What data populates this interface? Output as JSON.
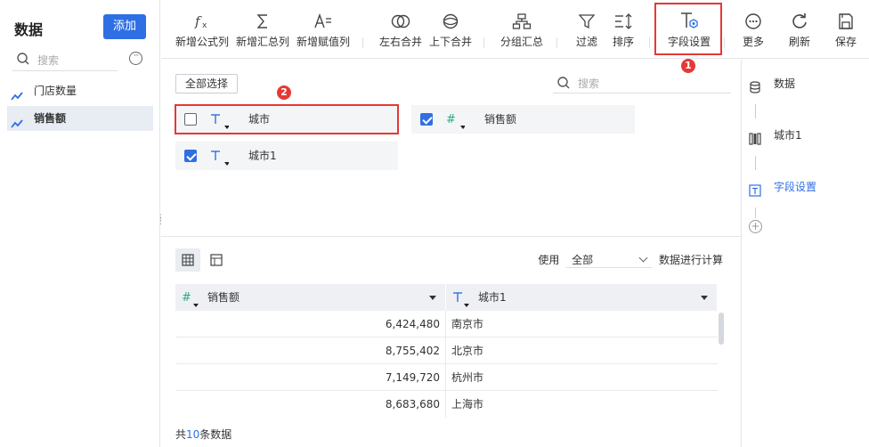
{
  "left_panel": {
    "title": "数据",
    "add_label": "添加",
    "search_placeholder": "搜索",
    "more_label": "···",
    "datasets": [
      {
        "label": "门店数量",
        "active": false
      },
      {
        "label": "销售额",
        "active": true
      }
    ]
  },
  "toolbar": {
    "items": [
      {
        "label": "新增公式列",
        "icon": "formula-icon"
      },
      {
        "label": "新增汇总列",
        "icon": "sigma-icon"
      },
      {
        "label": "新增赋值列",
        "icon": "assign-icon"
      },
      {
        "label": "左右合并",
        "icon": "merge-horizontal-icon"
      },
      {
        "label": "上下合并",
        "icon": "merge-vertical-icon"
      },
      {
        "label": "分组汇总",
        "icon": "group-summary-icon"
      },
      {
        "label": "过滤",
        "icon": "filter-icon"
      },
      {
        "label": "排序",
        "icon": "sort-icon"
      },
      {
        "label": "字段设置",
        "icon": "field-settings-icon"
      },
      {
        "label": "更多",
        "icon": "more-icon"
      },
      {
        "label": "刷新",
        "icon": "refresh-icon"
      },
      {
        "label": "保存",
        "icon": "save-icon"
      }
    ],
    "annotation": "1"
  },
  "field_panel": {
    "select_all_label": "全部选择",
    "search_placeholder": "搜索",
    "annotation": "2",
    "fields": [
      {
        "name": "城市",
        "type": "text",
        "checked": false
      },
      {
        "name": "销售额",
        "type": "number",
        "checked": true
      },
      {
        "name": "城市1",
        "type": "text",
        "checked": true
      }
    ]
  },
  "grid": {
    "use_label": "使用",
    "scope_value": "全部",
    "calc_label": "数据进行计算",
    "columns": [
      {
        "label": "销售额",
        "type": "number"
      },
      {
        "label": "城市1",
        "type": "text"
      }
    ],
    "rows": [
      [
        "6,424,480",
        "南京市"
      ],
      [
        "8,755,402",
        "北京市"
      ],
      [
        "7,149,720",
        "杭州市"
      ],
      [
        "8,683,680",
        "上海市"
      ]
    ],
    "footer_prefix": "共",
    "footer_count": "10",
    "footer_suffix": "条数据"
  },
  "steps": [
    {
      "label": "数据",
      "icon": "database-icon",
      "active": false
    },
    {
      "label": "城市1",
      "icon": "column-icon",
      "active": false
    },
    {
      "label": "字段设置",
      "icon": "field-settings-icon",
      "active": true
    }
  ],
  "colors": {
    "accent": "#2f6fe4",
    "highlight": "#e53935",
    "number_type": "#2fa88a"
  }
}
